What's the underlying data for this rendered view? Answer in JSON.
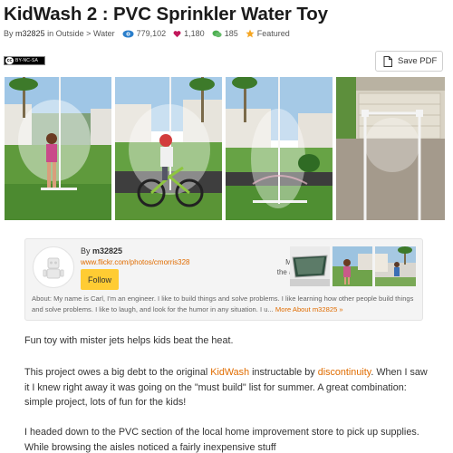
{
  "title": "KidWash 2 : PVC Sprinkler Water Toy",
  "meta": {
    "by_prefix": "By",
    "author": "m32825",
    "in_word": "in",
    "category": "Outside",
    "sep": ">",
    "subcategory": "Water",
    "views": "779,102",
    "favorites": "1,180",
    "comments": "185",
    "featured": "Featured"
  },
  "license": {
    "cc": "cc",
    "text": "BY-NC-SA"
  },
  "save_pdf": "Save PDF",
  "author_box": {
    "by_prefix": "By",
    "name": "m32825",
    "url": "www.flickr.com/photos/cmorris328",
    "follow": "Follow",
    "more_by_line1": "More by",
    "more_by_line2": "the author:",
    "about": "About: My name is Carl, I'm an engineer. I like to build things and solve problems. I like learning how other people build things and solve problems. I like to laugh, and look for the humor in any situation. I u...",
    "more_about": "More About m32825 »"
  },
  "body": {
    "p1": "Fun toy with mister jets helps kids beat the heat.",
    "p2_a": "This project owes a big debt to the original ",
    "p2_link1": "KidWash",
    "p2_b": " instructable by ",
    "p2_link2": "discontinuity",
    "p2_c": ". When I saw it I knew right away it was going on the \"must build\" list for summer. A great combination: simple project, lots of fun for the kids!",
    "p3": "I headed down to the PVC section of the local home improvement store to pick up supplies. While browsing the aisles noticed a fairly inexpensive stuff "
  },
  "colors": {
    "accent": "#e06c00",
    "follow_button": "#ffcc33",
    "views_icon": "#2a7ecb",
    "favorites_icon": "#c2185b",
    "comments_icon": "#4caf50",
    "featured_icon": "#f5a623"
  },
  "icons": [
    "eye-icon",
    "heart-icon",
    "comment-icon",
    "star-icon",
    "pdf-icon",
    "robot-avatar-icon"
  ]
}
